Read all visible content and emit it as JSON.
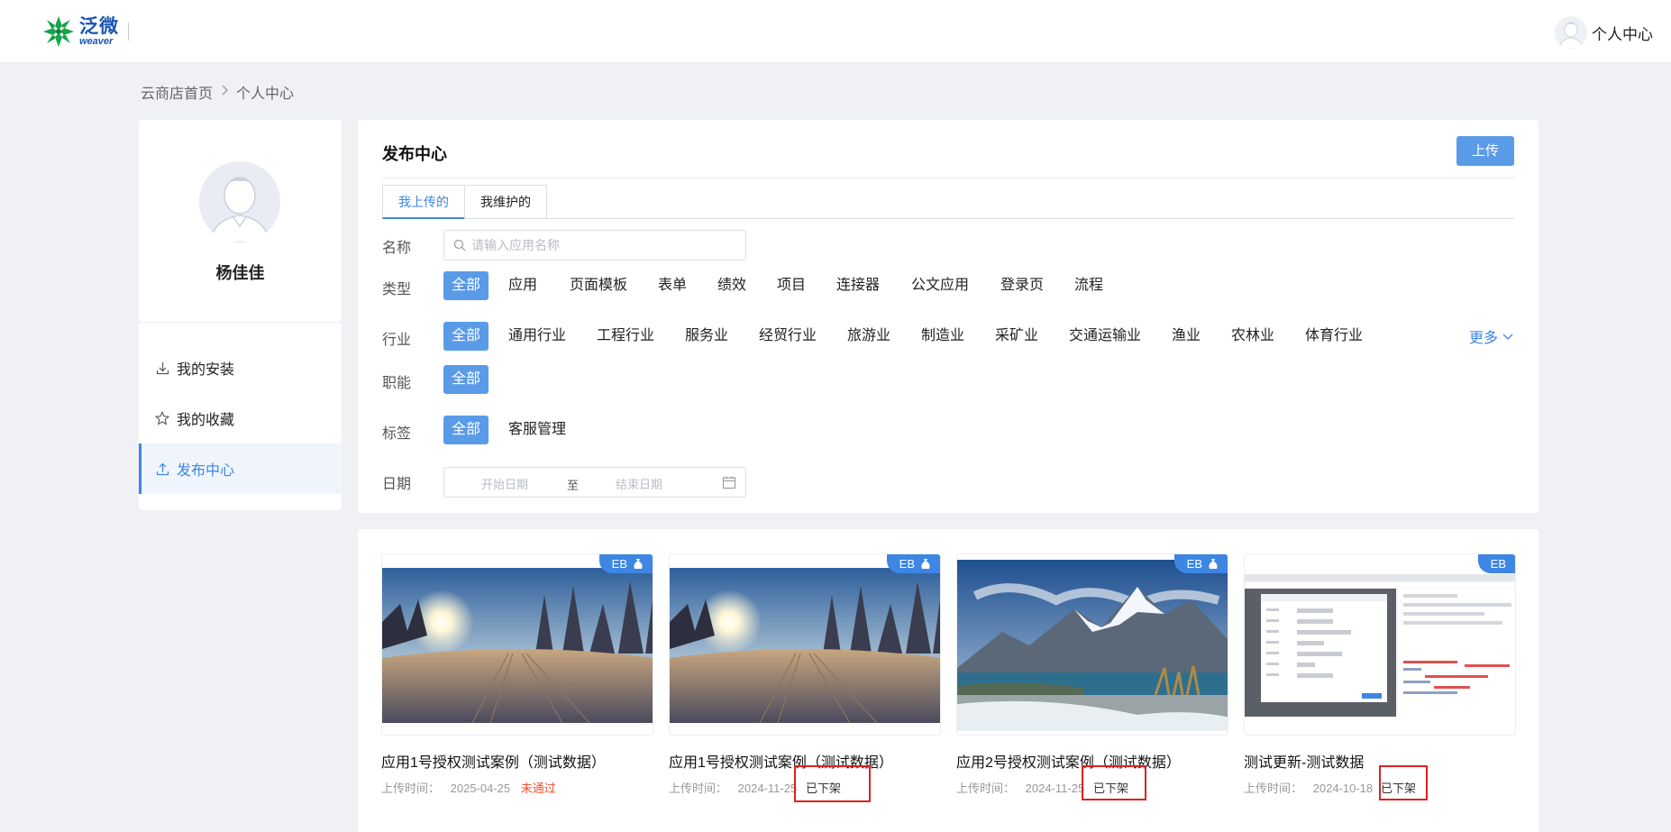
{
  "header": {
    "logo_cn": "泛微",
    "logo_en": "weaver",
    "user_center": "个人中心"
  },
  "breadcrumb": {
    "home": "云商店首页",
    "sep": ">",
    "current": "个人中心"
  },
  "profile": {
    "name": "杨佳佳"
  },
  "menu": {
    "items": [
      {
        "label": "我的安装",
        "icon": "download-icon"
      },
      {
        "label": "我的收藏",
        "icon": "star-icon"
      },
      {
        "label": "发布中心",
        "icon": "upload-icon"
      }
    ]
  },
  "publish": {
    "title": "发布中心",
    "upload_btn": "上传",
    "tabs": [
      "我上传的",
      "我维护的"
    ],
    "filters": {
      "name_label": "名称",
      "name_placeholder": "请输入应用名称",
      "type_label": "类型",
      "types": [
        "全部",
        "应用",
        "页面模板",
        "表单",
        "绩效",
        "项目",
        "连接器",
        "公文应用",
        "登录页",
        "流程"
      ],
      "industry_label": "行业",
      "industries": [
        "全部",
        "通用行业",
        "工程行业",
        "服务业",
        "经贸行业",
        "旅游业",
        "制造业",
        "采矿业",
        "交通运输业",
        "渔业",
        "农林业",
        "体育行业"
      ],
      "more": "更多",
      "function_label": "职能",
      "functions": [
        "全部"
      ],
      "tag_label": "标签",
      "tags": [
        "全部",
        "客服管理"
      ],
      "date_label": "日期",
      "date_start": "开始日期",
      "date_to": "至",
      "date_end": "结束日期"
    }
  },
  "apps": [
    {
      "name": "应用1号授权测试案例（测试数据）",
      "upload_label": "上传时间：",
      "date": "2025-04-25",
      "status": "未通过",
      "badge": "EB",
      "image": "snow-sunrise"
    },
    {
      "name": "应用1号授权测试案例（测试数据）",
      "upload_label": "上传时间：",
      "date": "2024-11-25",
      "status": "已下架",
      "badge": "EB",
      "image": "snow-sunrise"
    },
    {
      "name": "应用2号授权测试案例（测试数据）",
      "upload_label": "上传时间：",
      "date": "2024-11-25",
      "status": "已下架",
      "badge": "EB",
      "image": "mountain-lake"
    },
    {
      "name": "测试更新-测试数据",
      "upload_label": "上传时间：",
      "date": "2024-10-18",
      "status": "已下架",
      "badge": "EB",
      "image": "screenshot"
    }
  ],
  "colors": {
    "primary": "#3d86e3",
    "button": "#5a9be8",
    "rejected": "#f0502d",
    "annotation": "#e02020"
  }
}
